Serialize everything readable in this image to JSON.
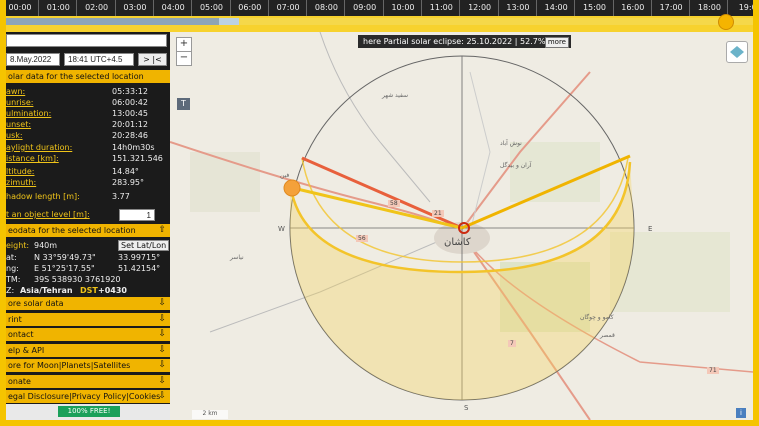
{
  "timeline": {
    "hours": [
      "00:00",
      "01:00",
      "02:00",
      "03:00",
      "04:00",
      "05:00",
      "06:00",
      "07:00",
      "08:00",
      "09:00",
      "10:00",
      "11:00",
      "12:00",
      "13:00",
      "14:00",
      "15:00",
      "16:00",
      "17:00",
      "18:00",
      "19:0"
    ]
  },
  "controls": {
    "search_value": "",
    "date_value": "8.May.2022",
    "time_value": "18:41 UTC+4.5",
    "nav_button": "> |<"
  },
  "solar": {
    "header": "olar data for the selected location",
    "rows": [
      {
        "label": "awn:",
        "value": "05:33:12"
      },
      {
        "label": "unrise:",
        "value": "06:00:42"
      },
      {
        "label": "ulmination:",
        "value": "13:00:45"
      },
      {
        "label": "unset:",
        "value": "20:01:12"
      },
      {
        "label": "usk:",
        "value": "20:28:46"
      }
    ],
    "rows2": [
      {
        "label": "aylight duration:",
        "value": "14h0m30s"
      },
      {
        "label": "istance [km]:",
        "value": "151.321.546"
      }
    ],
    "rows3": [
      {
        "label": "ltitude:",
        "value": "14.84°"
      },
      {
        "label": "zimuth:",
        "value": "283.95°"
      }
    ],
    "shadow_label": "hadow length [m]:",
    "shadow_value": "3.77",
    "object_level_label": "t an object level [m]:",
    "object_level_value": "1"
  },
  "geodata": {
    "header": "eodata for the selected location",
    "height_label": "eight:",
    "height_value": "940m",
    "set_button": "Set Lat/Lon",
    "lat_label": "at:",
    "lat_dms": "N 33°59'49.73\"",
    "lat_dec": "33.99715°",
    "lng_label": "ng:",
    "lng_dms": "E 51°25'17.55\"",
    "lng_dec": "51.42154°",
    "utm_label": "TM:",
    "utm_value": "39S 538930 3761920",
    "tz_label": "Z:",
    "tz_value": "Asia/Tehran",
    "dst": "DST",
    "offset": "+0430"
  },
  "sections": [
    "ore solar data",
    "rint",
    "ontact",
    "elp & API",
    "ore for Moon|Planets|Satellites",
    "onate",
    "egal Disclosure|Privacy Policy|Cookies"
  ],
  "ad": {
    "badge": "100% FREE!"
  },
  "map": {
    "zoom_in": "+",
    "zoom_out": "−",
    "t_button": "T",
    "info": "here Partial solar eclipse: 25.10.2022 | 52.7%",
    "more": "more",
    "scale": "2 km",
    "info_icon": "i",
    "compass": {
      "w": "W",
      "e": "E",
      "s": "S"
    },
    "city_label": "کاشان",
    "road_labels": [
      "58",
      "21",
      "56",
      "7",
      "71"
    ],
    "place_labels": [
      "سفید شهر",
      "آران و بیدگل",
      "نوش آباد",
      "فین",
      "نیاسر",
      "کامو و چوگان",
      "قمصر"
    ]
  },
  "colors": {
    "accent": "#f5c400",
    "sunrise_line": "#f0b400",
    "sunset_line": "#e8603c",
    "panel_bg": "#1b1b1b"
  }
}
